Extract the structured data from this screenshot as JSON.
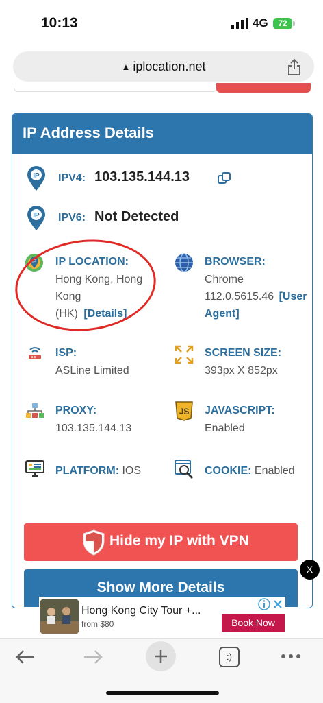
{
  "status_bar": {
    "time": "10:13",
    "network": "4G",
    "battery": "72"
  },
  "browser": {
    "url": "iplocation.net"
  },
  "card": {
    "title": "IP Address Details",
    "ipv4": {
      "label": "IPV4:",
      "value": "103.135.144.13"
    },
    "ipv6": {
      "label": "IPV6:",
      "value": "Not Detected"
    },
    "location": {
      "label": "IP LOCATION:",
      "line1": "Hong Kong, Hong",
      "line2": "Kong",
      "line3": "(HK)",
      "link": "[Details]"
    },
    "browser": {
      "label": "BROWSER:",
      "line1": "Chrome",
      "line2": "112.0.5615.46",
      "link1": "[User",
      "link2": "Agent]"
    },
    "isp": {
      "label": "ISP:",
      "value": "ASLine Limited"
    },
    "screen": {
      "label": "SCREEN SIZE:",
      "value": "393px X 852px"
    },
    "proxy": {
      "label": "PROXY:",
      "value": "103.135.144.13"
    },
    "javascript": {
      "label": "JAVASCRIPT:",
      "value": "Enabled"
    },
    "platform": {
      "label": "PLATFORM:",
      "value": "IOS"
    },
    "cookie": {
      "label": "COOKIE:",
      "value": "Enabled"
    },
    "vpn_button": "Hide my IP with VPN",
    "more_button": "Show More Details"
  },
  "close_ad": "X",
  "ad": {
    "title": "Hong Kong City Tour +...",
    "price": "from $80",
    "cta": "Book Now"
  },
  "toolbar": {
    "tabs_label": ":)"
  },
  "colors": {
    "accent": "#2c75ad",
    "vpn": "#f05352",
    "highlight": "#e02a25",
    "ad_cta": "#c4184a"
  }
}
